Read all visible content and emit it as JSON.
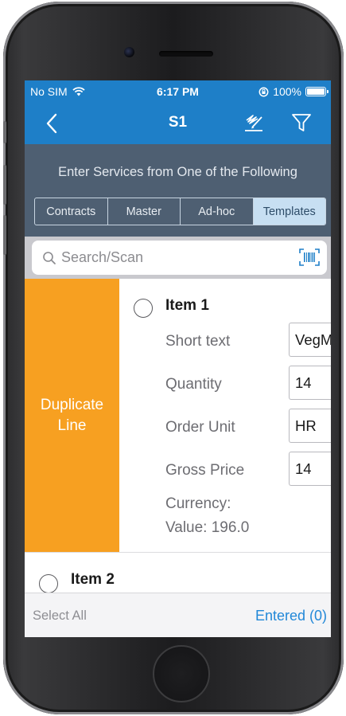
{
  "status_bar": {
    "carrier": "No SIM",
    "time": "6:17 PM",
    "battery": "100%"
  },
  "nav": {
    "title": "S1",
    "back_icon": "chevron-left-icon",
    "edit_icon": "signature-edit-icon",
    "filter_icon": "filter-funnel-icon"
  },
  "source": {
    "prompt": "Enter Services from One of the Following",
    "tabs": [
      {
        "label": "Contracts",
        "selected": false
      },
      {
        "label": "Master",
        "selected": false
      },
      {
        "label": "Ad-hoc",
        "selected": false
      },
      {
        "label": "Templates",
        "selected": true
      }
    ]
  },
  "search": {
    "placeholder": "Search/Scan",
    "barcode_icon": "barcode-scan-icon"
  },
  "swipe_action": {
    "line1": "Duplicate",
    "line2": "Line"
  },
  "items": [
    {
      "title": "Item 1",
      "fields": [
        {
          "label": "Short text",
          "value": "VegM"
        },
        {
          "label": "Quantity",
          "value": "14"
        },
        {
          "label": "Order Unit",
          "value": "HR"
        },
        {
          "label": "Gross Price",
          "value": "14"
        }
      ],
      "currency_label": "Currency:",
      "value_label": "Value: 196.0"
    },
    {
      "title": "Item 2"
    }
  ],
  "footer": {
    "select_all": "Select All",
    "entered": "Entered (0)"
  },
  "colors": {
    "nav_blue": "#1e7fc8",
    "header_slate": "#4e5f72",
    "duplicate_orange": "#f7a021",
    "selected_tab": "#c7dff2",
    "link_blue": "#2288d8"
  }
}
